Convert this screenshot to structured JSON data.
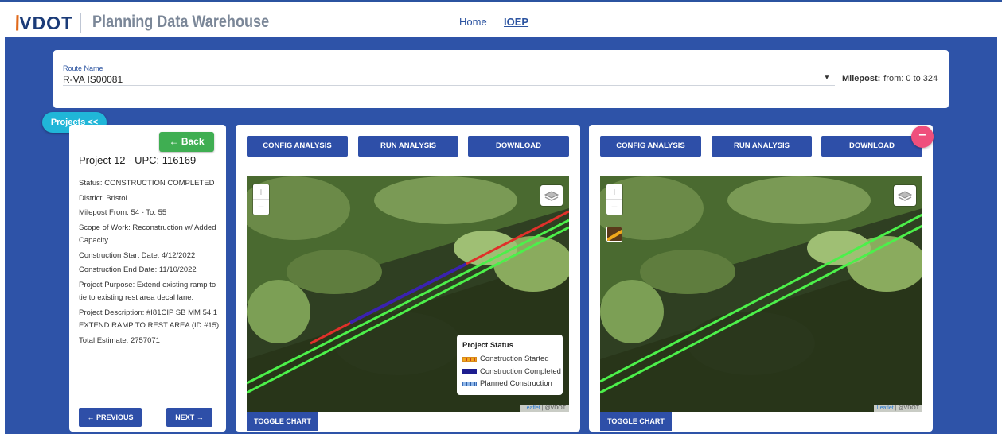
{
  "header": {
    "logo_text": "VDOT",
    "app_title": "Planning Data Warehouse",
    "nav": [
      {
        "label": "Home"
      },
      {
        "label": "IOEP"
      }
    ]
  },
  "route": {
    "label": "Route Name",
    "value": "R-VA IS00081",
    "milepost_label": "Milepost:",
    "milepost_value": "from: 0 to 324"
  },
  "projects_tab": {
    "label": "Projects <<"
  },
  "project": {
    "back_label": "← Back",
    "title": "Project 12 - UPC: 116169",
    "details": [
      "Status: CONSTRUCTION COMPLETED",
      "District: Bristol",
      "Milepost From: 54 - To: 55",
      "Scope of Work: Reconstruction w/ Added Capacity",
      "Construction Start Date: 4/12/2022",
      "Construction End Date: 11/10/2022",
      "Project Purpose: Extend existing ramp to tie to existing rest area decal lane.",
      "Project Description: #I81CIP SB MM 54.1 EXTEND RAMP TO REST AREA (ID #15)",
      "Total Estimate: 2757071"
    ],
    "prev_label": "← PREVIOUS",
    "next_label": "NEXT →"
  },
  "map_panels": {
    "config_label": "CONFIG ANALYSIS",
    "run_label": "RUN ANALYSIS",
    "download_label": "DOWNLOAD",
    "toggle_label": "TOGGLE CHART",
    "zoom_in": "+",
    "zoom_out": "−",
    "attribution_leaflet": "Leaflet",
    "attribution_sep": " | ",
    "attribution_owner": "@VDOT",
    "close_symbol": "−"
  },
  "legend": {
    "title": "Project Status",
    "items": [
      {
        "label": "Construction Started",
        "color": "#f0a81b"
      },
      {
        "label": "Construction Completed",
        "color": "#1d1d8f"
      },
      {
        "label": "Planned Construction",
        "color": "#8fb6e8"
      }
    ]
  },
  "colors": {
    "brand_blue": "#2e53a8",
    "button_blue": "#2e4fa8",
    "back_green": "#3fae52",
    "tab_cyan": "#20b6d8",
    "close_pink": "#ef4f7c",
    "route_green": "#4cf04a",
    "route_red": "#e0302a",
    "route_purple": "#3a22b0"
  }
}
